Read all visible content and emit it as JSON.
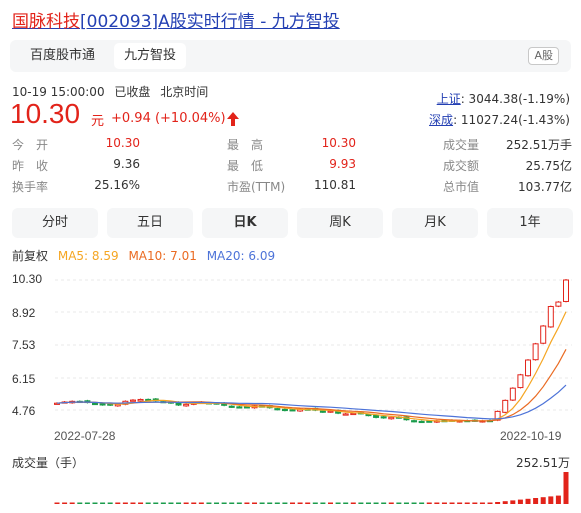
{
  "header": {
    "title_name": "国脉科技",
    "title_code": "[002093]",
    "title_rest": "A股实时行情 - 九方智投"
  },
  "tabs": [
    "百度股市通",
    "九方智投"
  ],
  "market_badge": "A股",
  "quote": {
    "datetime": "10-19 15:00:00",
    "status": "已收盘",
    "timezone": "北京时间",
    "price": "10.30",
    "unit": "元",
    "change": "+0.94 (+10.04%)"
  },
  "indices": [
    {
      "label": "上证",
      "value": ": 3044.38(-1.19%)"
    },
    {
      "label": "深成",
      "value": ": 11027.24(-1.43%)"
    }
  ],
  "stats": [
    [
      {
        "label": "今　开",
        "value": "10.30",
        "color": "red"
      },
      {
        "label": "最　高",
        "value": "10.30",
        "color": "red"
      },
      {
        "label": "成交量",
        "value": "252.51万手",
        "color": "dark"
      }
    ],
    [
      {
        "label": "昨　收",
        "value": "9.36",
        "color": "dark"
      },
      {
        "label": "最　低",
        "value": "9.93",
        "color": "red"
      },
      {
        "label": "成交额",
        "value": "25.75亿",
        "color": "dark"
      }
    ],
    [
      {
        "label": "换手率",
        "value": "25.16%",
        "color": "dark"
      },
      {
        "label": "市盈(TTM)",
        "value": "110.81",
        "color": "dark"
      },
      {
        "label": "总市值",
        "value": "103.77亿",
        "color": "dark"
      }
    ]
  ],
  "periods": [
    "分时",
    "五日",
    "日K",
    "周K",
    "月K",
    "1年"
  ],
  "active_period": "日K",
  "legend": {
    "adjust": "前复权",
    "ma5": "MA5: 8.59",
    "ma10": "MA10: 7.01",
    "ma20": "MA20: 6.09"
  },
  "chart_data": {
    "type": "candlestick",
    "y_ticks": [
      "10.30",
      "8.92",
      "7.53",
      "6.15",
      "4.76"
    ],
    "x_labels": [
      "2022-07-28",
      "2022-10-19"
    ],
    "volume_label": "成交量（手）",
    "volume_max": "252.51万",
    "colors": {
      "up": "#e2231a",
      "down": "#1b9c4c",
      "ma5": "#f5a623",
      "ma10": "#ea6b23",
      "ma20": "#4d73d8"
    }
  }
}
